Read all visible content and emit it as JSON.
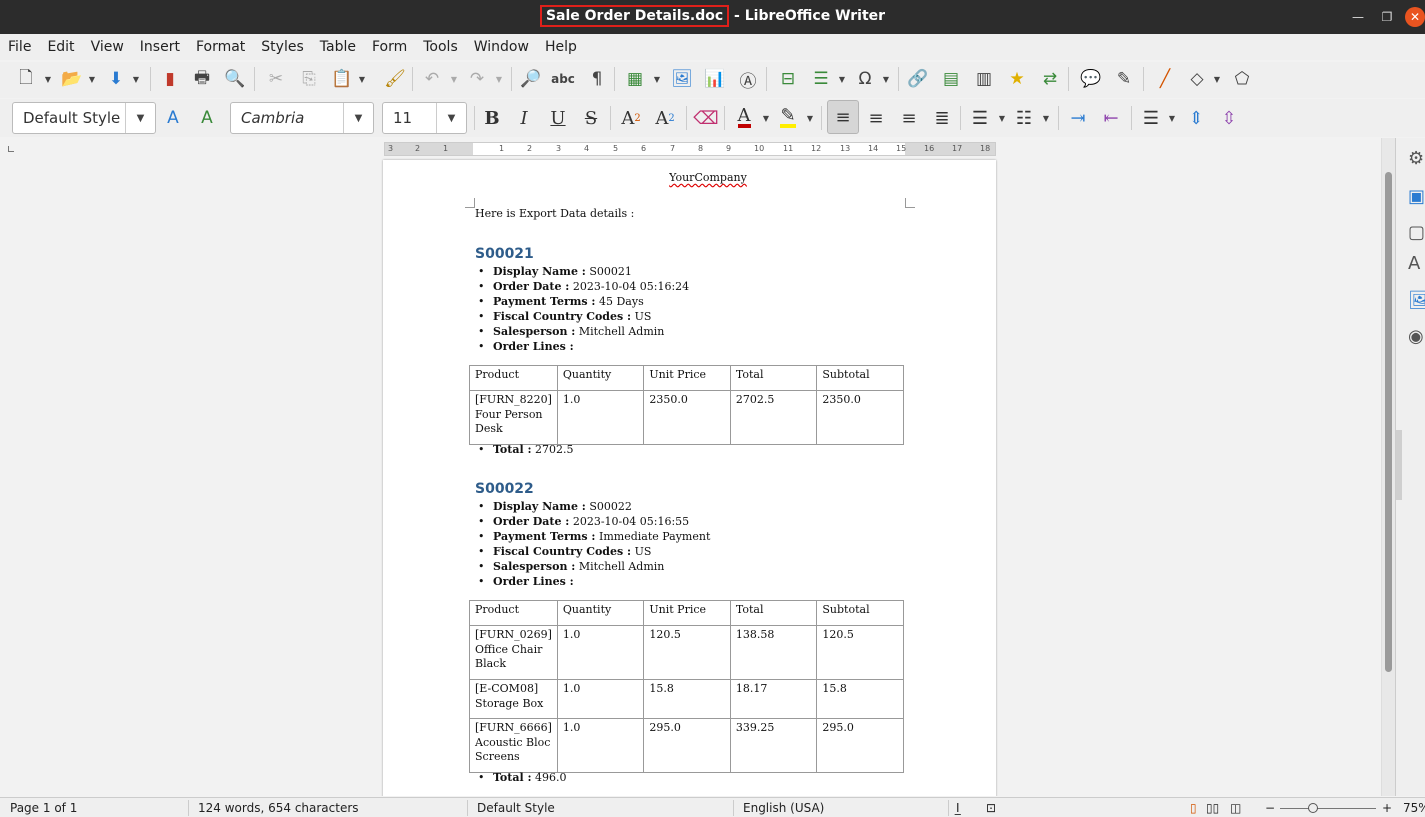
{
  "window": {
    "doc_name": "Sale Order Details.doc",
    "app_suffix": " - LibreOffice Writer"
  },
  "menu": [
    "File",
    "Edit",
    "View",
    "Insert",
    "Format",
    "Styles",
    "Table",
    "Form",
    "Tools",
    "Window",
    "Help"
  ],
  "formatting": {
    "paragraph_style": "Default Style",
    "font_name": "Cambria",
    "font_size": "11"
  },
  "ruler": {
    "ticks": [
      "3",
      "2",
      "1",
      "1",
      "2",
      "3",
      "4",
      "5",
      "6",
      "7",
      "8",
      "9",
      "10",
      "11",
      "12",
      "13",
      "14",
      "15",
      "16",
      "17",
      "18"
    ]
  },
  "document": {
    "company": "YourCompany",
    "intro": "Here is Export Data details :",
    "headers": [
      "Product",
      "Quantity",
      "Unit Price",
      "Total",
      "Subtotal"
    ],
    "orders": [
      {
        "id": "S00021",
        "fields": [
          {
            "label": "Display Name :",
            "value": " S00021"
          },
          {
            "label": "Order Date :",
            "value": " 2023-10-04 05:16:24"
          },
          {
            "label": "Payment Terms :",
            "value": " 45 Days"
          },
          {
            "label": "Fiscal Country Codes :",
            "value": " US"
          },
          {
            "label": "Salesperson :",
            "value": " Mitchell Admin"
          },
          {
            "label": "Order Lines :",
            "value": ""
          }
        ],
        "rows": [
          [
            "[FURN_8220] Four Person Desk",
            "1.0",
            "2350.0",
            "2702.5",
            "2350.0"
          ]
        ],
        "total_label": "Total :",
        "total_value": " 2702.5"
      },
      {
        "id": "S00022",
        "fields": [
          {
            "label": "Display Name :",
            "value": " S00022"
          },
          {
            "label": "Order Date :",
            "value": " 2023-10-04 05:16:55"
          },
          {
            "label": "Payment Terms :",
            "value": " Immediate Payment"
          },
          {
            "label": "Fiscal Country Codes :",
            "value": " US"
          },
          {
            "label": "Salesperson :",
            "value": " Mitchell Admin"
          },
          {
            "label": "Order Lines :",
            "value": ""
          }
        ],
        "rows": [
          [
            "[FURN_0269] Office Chair Black",
            "1.0",
            "120.5",
            "138.58",
            "120.5"
          ],
          [
            "[E-COM08] Storage Box",
            "1.0",
            "15.8",
            "18.17",
            "15.8"
          ],
          [
            "[FURN_6666] Acoustic Bloc Screens",
            "1.0",
            "295.0",
            "339.25",
            "295.0"
          ]
        ],
        "total_label": "Total :",
        "total_value": " 496.0"
      }
    ]
  },
  "status": {
    "page": "Page 1 of 1",
    "words": "124 words, 654 characters",
    "style": "Default Style",
    "language": "English (USA)",
    "zoom": "75%"
  }
}
